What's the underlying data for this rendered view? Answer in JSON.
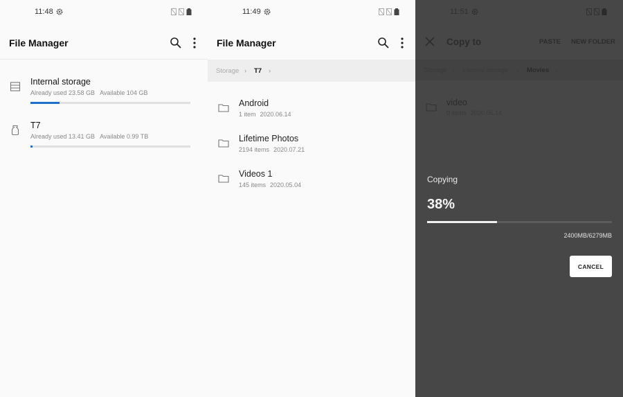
{
  "panel1": {
    "time": "11:48",
    "title": "File Manager",
    "storage": [
      {
        "name": "Internal storage",
        "used": "Already used 23.58 GB",
        "available": "Available 104 GB",
        "usage": 0.18
      },
      {
        "name": "T7",
        "used": "Already used 13.41 GB",
        "available": "Available 0.99 TB",
        "usage": 0.013
      }
    ]
  },
  "panel2": {
    "time": "11:49",
    "title": "File Manager",
    "breadcrumb": [
      "Storage",
      "T7"
    ],
    "folders": [
      {
        "name": "Android",
        "count": "1 item",
        "date": "2020.06.14"
      },
      {
        "name": "Lifetime Photos",
        "count": "2194 items",
        "date": "2020.07.21"
      },
      {
        "name": "Videos 1",
        "count": "145 items",
        "date": "2020.05.04"
      }
    ]
  },
  "panel3": {
    "time": "11:51",
    "title": "Copy to",
    "paste_label": "PASTE",
    "new_folder_label": "NEW FOLDER",
    "breadcrumb": [
      "Storage",
      "Internal storage",
      "Movies"
    ],
    "folder": {
      "name": "video",
      "count": "0 items",
      "date": "2020.06.14"
    },
    "dialog": {
      "label": "Copying",
      "percent_text": "38%",
      "progress": 0.38,
      "size_text": "2400MB/6279MB",
      "cancel_label": "CANCEL"
    }
  },
  "colors": {
    "accent": "#1e6fc9",
    "overlay": "#474747"
  },
  "icons": [
    "gear-icon",
    "search-icon",
    "more-vert-icon",
    "storage-icon",
    "usb-drive-icon",
    "folder-icon",
    "close-icon",
    "chevron-right-icon"
  ]
}
